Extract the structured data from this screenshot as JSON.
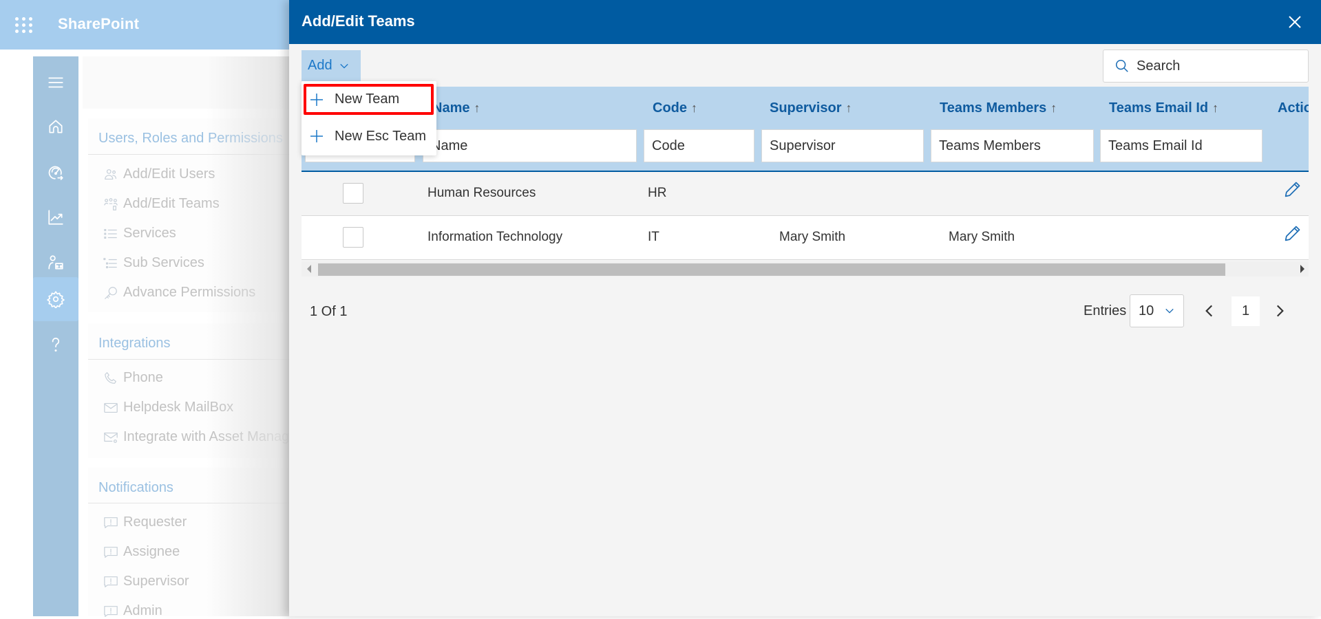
{
  "topbar": {
    "brand": "SharePoint"
  },
  "rail": {
    "items": [
      {
        "name": "menu",
        "icon": "hamburger-icon"
      },
      {
        "name": "home",
        "icon": "home-icon"
      },
      {
        "name": "dashboard",
        "icon": "gauge-icon"
      },
      {
        "name": "reports",
        "icon": "chart-icon"
      },
      {
        "name": "users",
        "icon": "user-group-icon"
      },
      {
        "name": "settings",
        "icon": "gear-icon",
        "active": true
      },
      {
        "name": "help",
        "icon": "help-icon"
      }
    ]
  },
  "settings": {
    "sections": [
      {
        "title": "Users, Roles and Permissions",
        "items": [
          "Add/Edit Users",
          "Add/Edit Teams",
          "Services",
          "Sub Services",
          "Advance Permissions"
        ]
      },
      {
        "title": "Integrations",
        "items": [
          "Phone",
          "Helpdesk MailBox",
          "Integrate with Asset Management"
        ]
      },
      {
        "title": "Notifications",
        "items": [
          "Requester",
          "Assignee",
          "Supervisor",
          "Admin"
        ]
      }
    ]
  },
  "panel": {
    "title": "Add/Edit Teams",
    "add_label": "Add",
    "search_placeholder": "Search",
    "dropdown": [
      "New Team",
      "New Esc Team"
    ],
    "columns": [
      {
        "label": "Name",
        "sort": "↑",
        "filter_placeholder": "Name"
      },
      {
        "label": "Code",
        "sort": "↑",
        "filter_placeholder": "Code"
      },
      {
        "label": "Supervisor",
        "sort": "↑",
        "filter_placeholder": "Supervisor"
      },
      {
        "label": "Teams Members",
        "sort": "↑",
        "filter_placeholder": "Teams Members"
      },
      {
        "label": "Teams Email Id",
        "sort": "↑",
        "filter_placeholder": "Teams Email Id"
      },
      {
        "label": "Action"
      }
    ],
    "rows": [
      {
        "name": "Human Resources",
        "code": "HR",
        "supervisor": "",
        "members": "",
        "email": ""
      },
      {
        "name": "Information Technology",
        "code": "IT",
        "supervisor": "Mary Smith",
        "members": "Mary Smith",
        "email": ""
      }
    ],
    "pager": {
      "info": "1 Of 1",
      "entries_label": "Entries",
      "entries_value": "10",
      "current_page": "1"
    }
  },
  "colors": {
    "title_bar": "#005ba1",
    "header_bg": "#b8d5ed",
    "accent": "#1c78c8",
    "highlight": "#ff0000"
  }
}
